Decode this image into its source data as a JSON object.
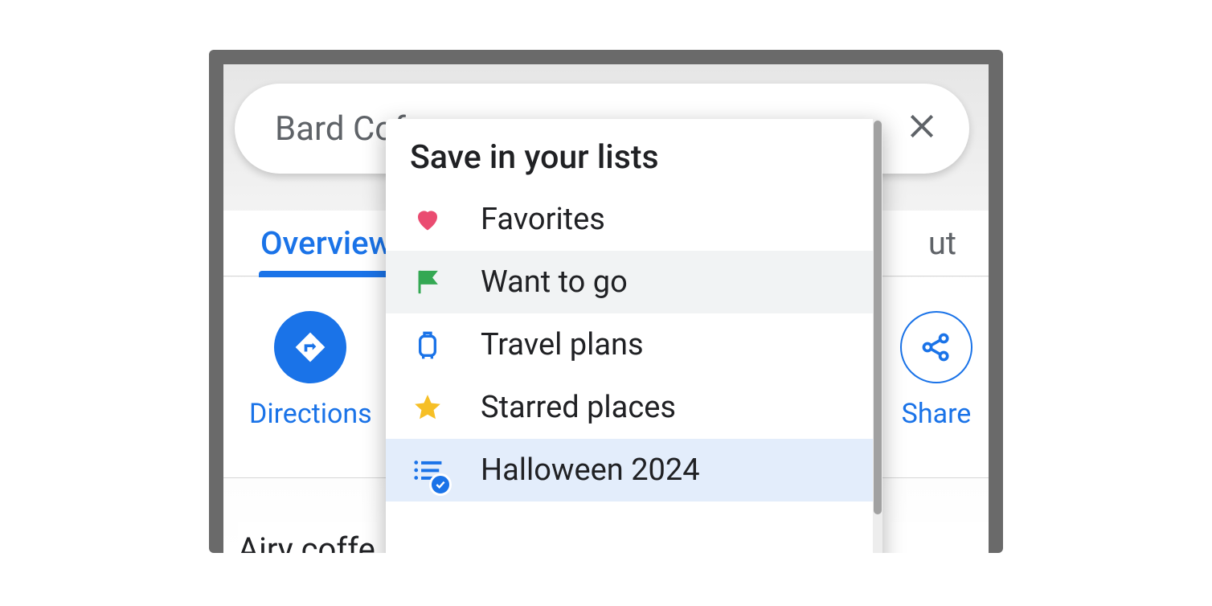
{
  "search": {
    "value": "Bard Cof"
  },
  "tabs": {
    "overview": "Overview",
    "about_partial": "ut"
  },
  "actions": {
    "directions": "Directions",
    "share": "Share"
  },
  "description_partial": "Airy coffe",
  "menu": {
    "title": "Save in your lists",
    "items": [
      {
        "icon": "heart",
        "label": "Favorites",
        "state": "normal"
      },
      {
        "icon": "flag",
        "label": "Want to go",
        "state": "hover"
      },
      {
        "icon": "suitcase",
        "label": "Travel plans",
        "state": "normal"
      },
      {
        "icon": "star",
        "label": "Starred places",
        "state": "normal"
      },
      {
        "icon": "list-check",
        "label": "Halloween 2024",
        "state": "selected"
      }
    ]
  },
  "colors": {
    "primary": "#1a73e8",
    "heart": "#ea4c71",
    "flag": "#34a853",
    "star": "#f6bf26"
  }
}
